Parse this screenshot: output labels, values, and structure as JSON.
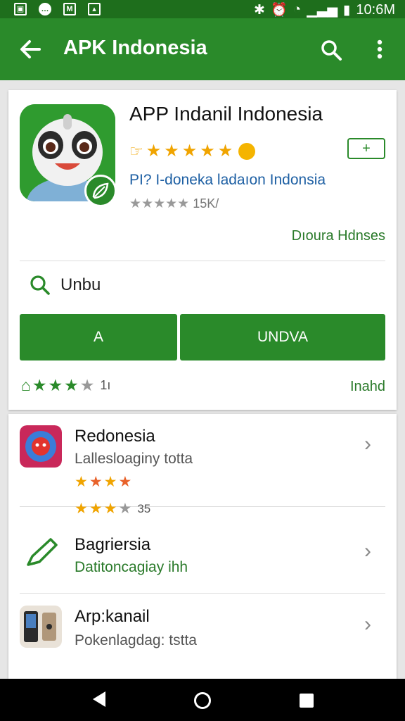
{
  "status_bar": {
    "time": "10:6M",
    "icons": [
      "screenshot-icon",
      "message-icon",
      "mail-icon",
      "photo-icon",
      "bluetooth-icon",
      "alarm-icon",
      "wifi-icon",
      "signal-icon",
      "battery-icon"
    ]
  },
  "app_bar": {
    "title": "APK Indonesia",
    "back_icon": "arrow-left-icon",
    "search_icon": "search-icon",
    "menu_icon": "more-vert-icon"
  },
  "app": {
    "name": "APP Indanil Indonesia",
    "stars": 5,
    "developer": "PI? I-doneka ladaıon Indonsia",
    "review_count": "15K/",
    "developer_link": "Dıoura Hdnses",
    "install_symbol": "+"
  },
  "search": {
    "text": "Unbu"
  },
  "buttons": {
    "left_label": "A",
    "right_label": "UNDVA"
  },
  "rating": {
    "stars": 3.5,
    "count": "1ı",
    "link": "Inahd"
  },
  "list": [
    {
      "title": "Redonesia",
      "subtitle": "Lallesloaginy totta",
      "stars": 4,
      "icon": "app-icon-blue-red"
    },
    {
      "stars": 3.5,
      "count": "35",
      "title": "Bagriersia",
      "subtitle": "Datitoncagiay ihh",
      "icon": "pencil-icon"
    },
    {
      "title": "Arp:kanail",
      "subtitle": "Pokenlagdag: tstta",
      "icon": "app-icon-phone"
    }
  ],
  "colors": {
    "primary": "#2a8a2a",
    "primary_dark": "#1e6e1c",
    "star": "#f0a400",
    "link_blue": "#1d5fa3"
  }
}
